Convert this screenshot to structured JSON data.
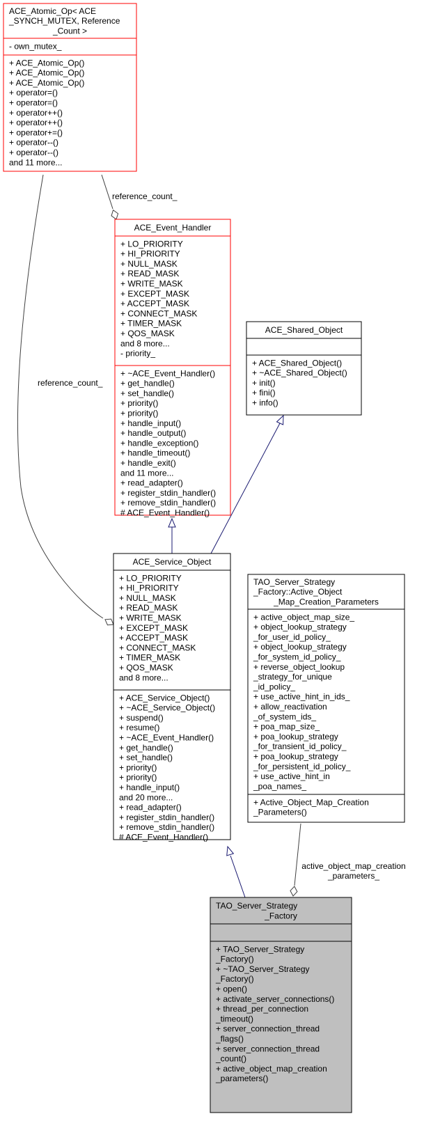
{
  "colors": {
    "red_border": "#ff0000",
    "black_border": "#000000",
    "focus_fill": "#bfbfbf",
    "inherit_edge": "#191970",
    "assoc_edge": "#404040"
  },
  "classes": [
    {
      "id": "atomic_op",
      "title": [
        "ACE_Atomic_Op< ACE",
        "_SYNCH_MUTEX, Reference",
        "_Count >"
      ],
      "attributes": [
        "- own_mutex_"
      ],
      "methods": [
        "+ ACE_Atomic_Op()",
        "+ ACE_Atomic_Op()",
        "+ ACE_Atomic_Op()",
        "+ operator=()",
        "+ operator=()",
        "+ operator++()",
        "+ operator++()",
        "+ operator+=()",
        "+ operator--()",
        "+ operator--()",
        "and 11 more..."
      ]
    },
    {
      "id": "event_handler",
      "title": [
        "ACE_Event_Handler"
      ],
      "attributes": [
        "+ LO_PRIORITY",
        "+ HI_PRIORITY",
        "+ NULL_MASK",
        "+ READ_MASK",
        "+ WRITE_MASK",
        "+ EXCEPT_MASK",
        "+ ACCEPT_MASK",
        "+ CONNECT_MASK",
        "+ TIMER_MASK",
        "+ QOS_MASK",
        "and 8 more...",
        "- priority_"
      ],
      "methods": [
        "+ ~ACE_Event_Handler()",
        "+ get_handle()",
        "+ set_handle()",
        "+ priority()",
        "+ priority()",
        "+ handle_input()",
        "+ handle_output()",
        "+ handle_exception()",
        "+ handle_timeout()",
        "+ handle_exit()",
        "and 11 more...",
        "+ read_adapter()",
        "+ register_stdin_handler()",
        "+ remove_stdin_handler()",
        "# ACE_Event_Handler()"
      ]
    },
    {
      "id": "shared_object",
      "title": [
        "ACE_Shared_Object"
      ],
      "attributes": [],
      "methods": [
        "+ ACE_Shared_Object()",
        "+ ~ACE_Shared_Object()",
        "+ init()",
        "+ fini()",
        "+ info()"
      ]
    },
    {
      "id": "service_object",
      "title": [
        "ACE_Service_Object"
      ],
      "attributes": [
        "+ LO_PRIORITY",
        "+ HI_PRIORITY",
        "+ NULL_MASK",
        "+ READ_MASK",
        "+ WRITE_MASK",
        "+ EXCEPT_MASK",
        "+ ACCEPT_MASK",
        "+ CONNECT_MASK",
        "+ TIMER_MASK",
        "+ QOS_MASK",
        "and 8 more..."
      ],
      "methods": [
        "+ ACE_Service_Object()",
        "+ ~ACE_Service_Object()",
        "+ suspend()",
        "+ resume()",
        "+ ~ACE_Event_Handler()",
        "+ get_handle()",
        "+ set_handle()",
        "+ priority()",
        "+ priority()",
        "+ handle_input()",
        "and 20 more...",
        "+ read_adapter()",
        "+ register_stdin_handler()",
        "+ remove_stdin_handler()",
        "# ACE_Event_Handler()"
      ]
    },
    {
      "id": "map_params",
      "title": [
        "TAO_Server_Strategy",
        "_Factory::Active_Object",
        "_Map_Creation_Parameters"
      ],
      "attributes": [
        "+ active_object_map_size_",
        "+ object_lookup_strategy",
        "_for_user_id_policy_",
        "+ object_lookup_strategy",
        "_for_system_id_policy_",
        "+ reverse_object_lookup",
        "_strategy_for_unique",
        "_id_policy_",
        "+ use_active_hint_in_ids_",
        "+ allow_reactivation",
        "_of_system_ids_",
        "+ poa_map_size_",
        "+ poa_lookup_strategy",
        "_for_transient_id_policy_",
        "+ poa_lookup_strategy",
        "_for_persistent_id_policy_",
        "+ use_active_hint_in",
        "_poa_names_"
      ],
      "methods": [
        "+ Active_Object_Map_Creation",
        "_Parameters()"
      ]
    },
    {
      "id": "strategy_factory",
      "title": [
        "TAO_Server_Strategy",
        "_Factory"
      ],
      "attributes": [],
      "methods": [
        "+ TAO_Server_Strategy",
        "_Factory()",
        "+ ~TAO_Server_Strategy",
        "_Factory()",
        "+ open()",
        "+ activate_server_connections()",
        "+ thread_per_connection",
        "_timeout()",
        "+ server_connection_thread",
        "_flags()",
        "+ server_connection_thread",
        "_count()",
        "+ active_object_map_creation",
        "_parameters()"
      ]
    }
  ],
  "edge_labels": {
    "atomic_to_handler": "reference_count_",
    "atomic_to_service": "reference_count_",
    "params_to_factory": [
      "active_object_map_creation",
      "_parameters_"
    ]
  }
}
